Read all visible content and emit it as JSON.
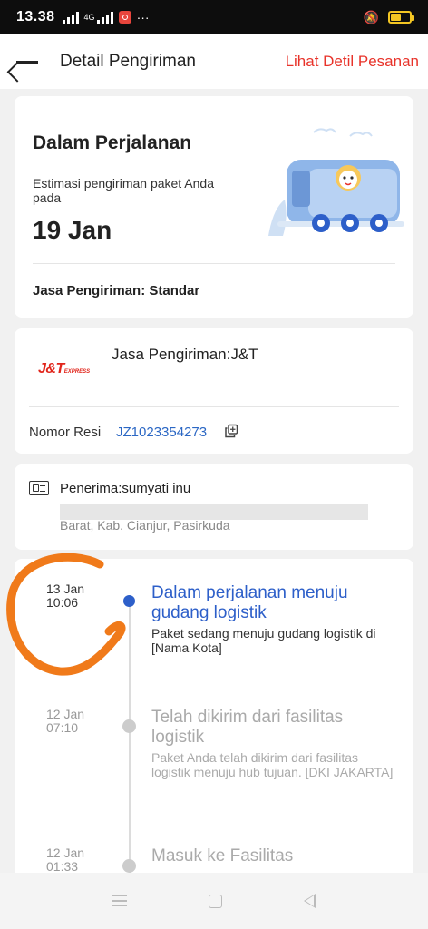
{
  "status_bar": {
    "time": "13.38",
    "network_label": "4G"
  },
  "header": {
    "title": "Detail Pengiriman",
    "order_link": "Lihat Detil Pesanan"
  },
  "status_card": {
    "status": "Dalam Perjalanan",
    "estimate_label": "Estimasi pengiriman paket Anda pada",
    "estimate_date": "19 Jan",
    "service": "Jasa Pengiriman: Standar"
  },
  "courier_card": {
    "logo_text": "J&T",
    "logo_subtext": "EXPRESS",
    "courier": "Jasa Pengiriman:J&T",
    "resi_label": "Nomor Resi",
    "resi_number": "JZ1023354273"
  },
  "receiver_card": {
    "receiver": "Penerima:sumyati inu",
    "address": "Barat, Kab. Cianjur, Pasirkuda"
  },
  "timeline": [
    {
      "date": "13 Jan",
      "time": "10:06",
      "title": "Dalam perjalanan menuju gudang logistik",
      "desc": "Paket sedang menuju gudang logistik di [Nama Kota]"
    },
    {
      "date": "12 Jan",
      "time": "07:10",
      "title": "Telah dikirim dari fasilitas logistik",
      "desc": "Paket Anda telah dikirim dari fasilitas logistik menuju hub tujuan. [DKI JAKARTA]"
    },
    {
      "date": "12 Jan",
      "time": "01:33",
      "title": "Masuk ke Fasilitas",
      "desc": ""
    }
  ],
  "colors": {
    "accent": "#e8332a",
    "active": "#2d5fc9",
    "link": "#2b67c4",
    "annotation": "#f07a1a"
  }
}
